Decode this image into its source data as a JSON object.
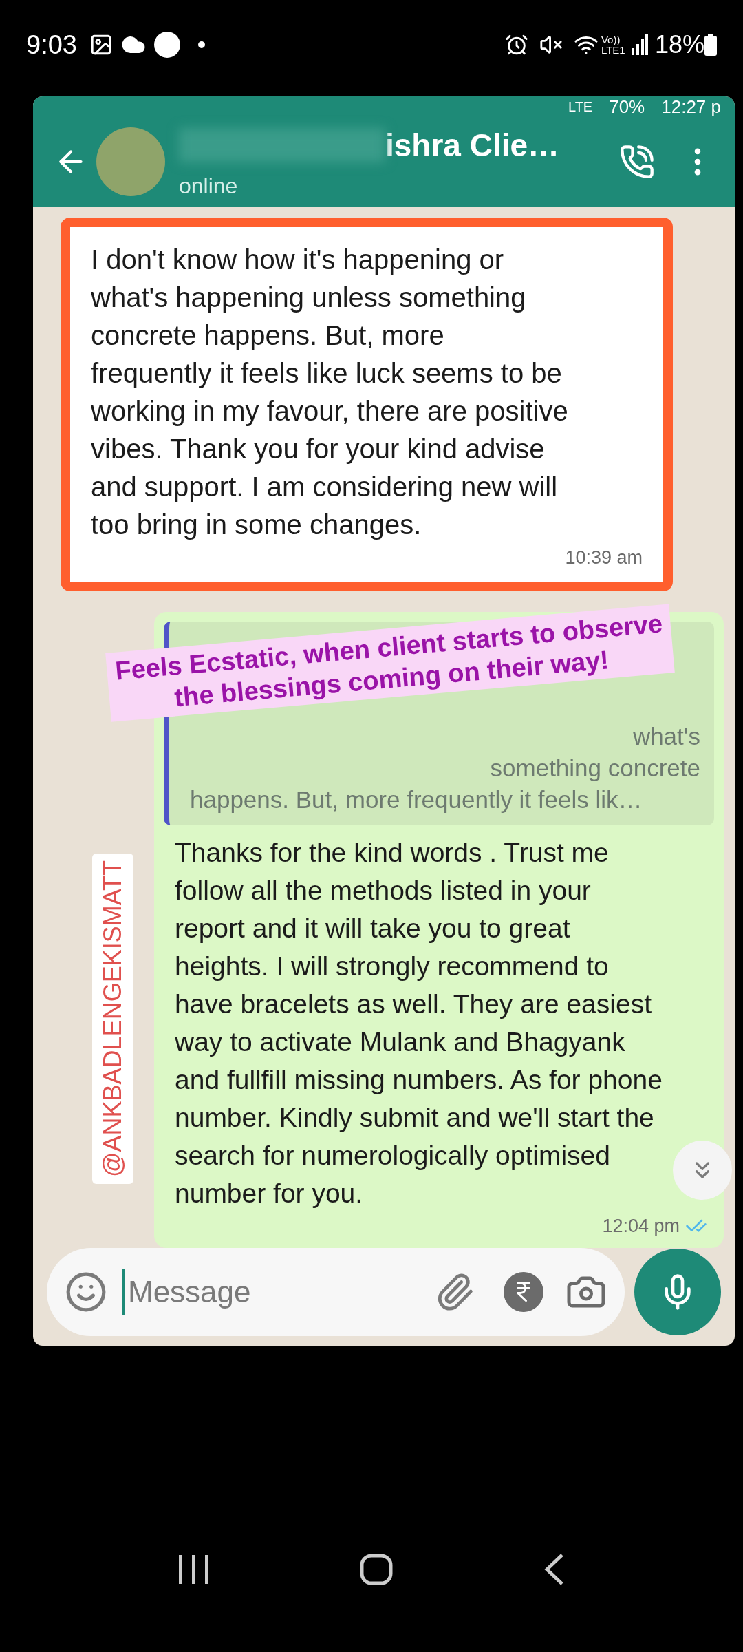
{
  "status_bar": {
    "time": "9:03",
    "battery": "18%",
    "network": "Vo)) LTE1"
  },
  "chat_screenshot": {
    "inner_status": {
      "network": "LTE",
      "battery": "70%",
      "time": "12:27 p"
    },
    "header": {
      "contact_name": "ishra Clie…",
      "status": "online"
    },
    "messages": [
      {
        "kind": "received",
        "highlighted": true,
        "text": "I don't know how it's happening or what's happening unless something concrete happens. But, more frequently it feels like luck seems to be working in my favour, there are positive vibes. Thank you for your kind advise and support. I am considering new will too bring in some changes.",
        "time": "10:39 am"
      },
      {
        "kind": "sent",
        "quote": [
          "what's",
          "something concrete",
          "happens. But, more frequently it feels lik…"
        ],
        "text": "Thanks for the kind words . Trust me follow all the methods listed in your report and it will take you to great heights. I will strongly recommend to have bracelets as well. They are easiest way to activate Mulank and Bhagyank and fullfill missing numbers. As for phone number. Kindly submit and we'll start the search for numerologically optimised number for you.",
        "time": "12:04 pm",
        "read": true
      }
    ],
    "input": {
      "placeholder": "Message"
    }
  },
  "caption": [
    "Feels Ecstatic, when client starts to observe",
    "the blessings coming on their way!"
  ],
  "handle": "@ANKBADLENGEKISMATT"
}
